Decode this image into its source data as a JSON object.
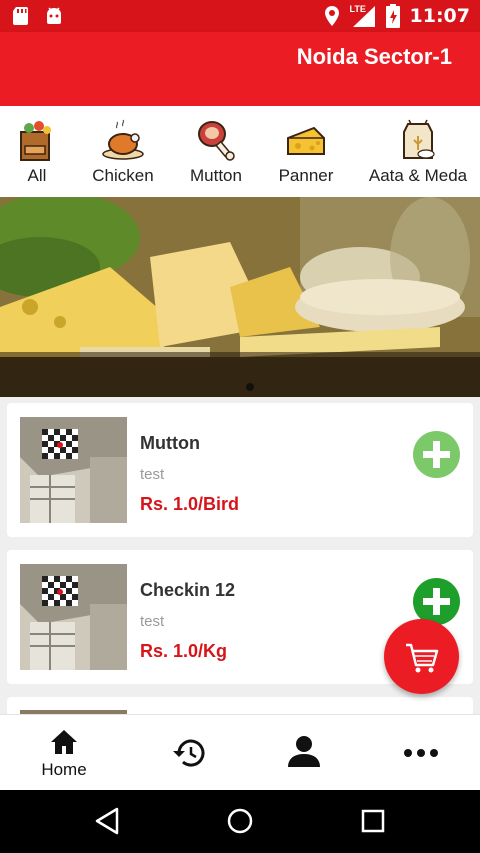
{
  "status_bar": {
    "time": "11:07",
    "network": "LTE",
    "icons": [
      "sd-card-icon",
      "android-icon",
      "location-icon",
      "signal-icon",
      "battery-icon"
    ]
  },
  "header": {
    "location": "Noida Sector-1",
    "color": "#ec1c24"
  },
  "categories": [
    {
      "label": "All",
      "icon": "grocery-bag-icon"
    },
    {
      "label": "Chicken",
      "icon": "roast-chicken-icon"
    },
    {
      "label": "Mutton",
      "icon": "meat-leg-icon"
    },
    {
      "label": "Panner",
      "icon": "cheese-icon"
    },
    {
      "label": "Aata & Meda",
      "icon": "flour-sack-icon"
    }
  ],
  "banner": {
    "slide_count": 1,
    "active_slide": 1
  },
  "products": [
    {
      "name": "Mutton",
      "description": "test",
      "price": "Rs. 1.0/Bird",
      "add_button_color": "#7cc96a"
    },
    {
      "name": "Checkin 12",
      "description": "test",
      "price": "Rs. 1.0/Kg",
      "add_button_color": "#1e9e2a"
    }
  ],
  "bottom_nav": [
    {
      "label": "Home",
      "icon": "home-icon"
    },
    {
      "label": "",
      "icon": "history-icon"
    },
    {
      "label": "",
      "icon": "profile-icon"
    },
    {
      "label": "",
      "icon": "more-icon"
    }
  ],
  "accent_color": "#d8141b"
}
